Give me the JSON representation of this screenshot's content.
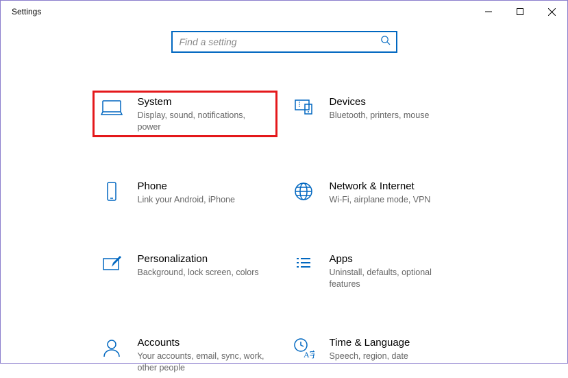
{
  "window": {
    "title": "Settings"
  },
  "search": {
    "placeholder": "Find a setting"
  },
  "tiles": [
    {
      "label": "System",
      "desc": "Display, sound, notifications, power"
    },
    {
      "label": "Devices",
      "desc": "Bluetooth, printers, mouse"
    },
    {
      "label": "Phone",
      "desc": "Link your Android, iPhone"
    },
    {
      "label": "Network & Internet",
      "desc": "Wi-Fi, airplane mode, VPN"
    },
    {
      "label": "Personalization",
      "desc": "Background, lock screen, colors"
    },
    {
      "label": "Apps",
      "desc": "Uninstall, defaults, optional features"
    },
    {
      "label": "Accounts",
      "desc": "Your accounts, email, sync, work, other people"
    },
    {
      "label": "Time & Language",
      "desc": "Speech, region, date"
    }
  ]
}
